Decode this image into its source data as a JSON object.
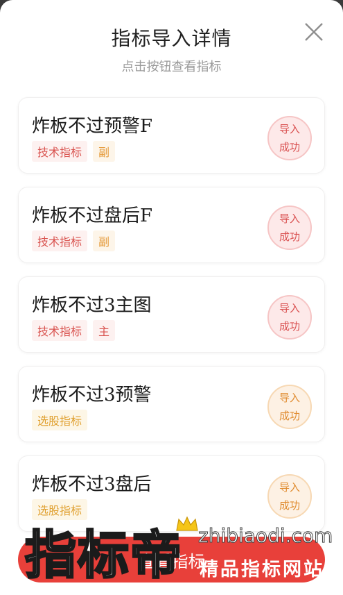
{
  "header": {
    "title": "指标导入详情",
    "subtitle": "点击按钮查看指标"
  },
  "icons": {
    "close": "close-icon",
    "crown": "crown-icon"
  },
  "items": [
    {
      "name": "炸板不过预警F",
      "tags": [
        "技术指标",
        "副"
      ],
      "status": [
        "导入",
        "成功"
      ],
      "status_color": "#d94f4f"
    },
    {
      "name": "炸板不过盘后F",
      "tags": [
        "技术指标",
        "副"
      ],
      "status": [
        "导入",
        "成功"
      ],
      "status_color": "#d94f4f"
    },
    {
      "name": "炸板不过3主图",
      "tags": [
        "技术指标",
        "主"
      ],
      "status": [
        "导入",
        "成功"
      ],
      "status_color": "#d94f4f"
    },
    {
      "name": "炸板不过3预警",
      "tags": [
        "选股指标"
      ],
      "status": [
        "导入",
        "成功"
      ],
      "status_color": "#e08a2d"
    },
    {
      "name": "炸板不过3盘后",
      "tags": [
        "选股指标"
      ],
      "status": [
        "导入",
        "成功"
      ],
      "status_color": "#e08a2d"
    }
  ],
  "footer": {
    "button_label": "查看指标"
  },
  "watermark": {
    "brand": "指标帝",
    "url": "zhibiaodi.com",
    "slogan": "精品指标网站"
  },
  "colors": {
    "accent": "#e8403a",
    "tag_red_text": "#d9534f",
    "tag_orange_text": "#e59a3a"
  }
}
